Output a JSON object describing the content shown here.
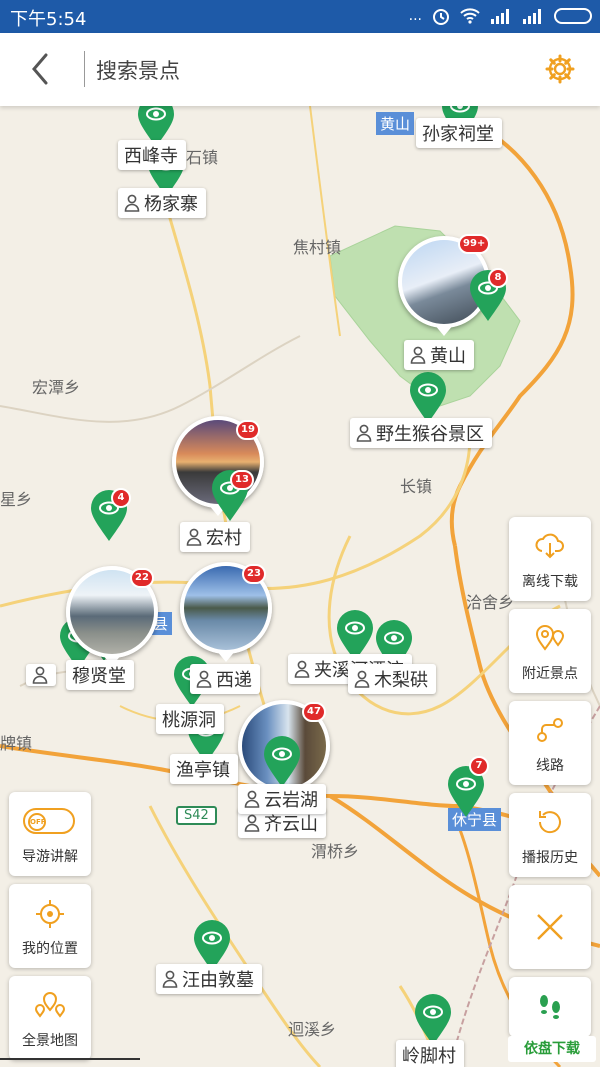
{
  "status": {
    "time": "下午5:54",
    "dots": "...",
    "colors": {
      "bar": "#1e5aa8"
    }
  },
  "header": {
    "title": "搜索景点",
    "back_icon": "chevron-left-icon",
    "settings_icon": "gear-icon"
  },
  "map": {
    "places": {
      "shi_zhen": "石镇",
      "jiao_cun": "焦村镇",
      "hong_tan": "宏潭乡",
      "xing_xiang": "星乡",
      "chang_zhen": "长镇",
      "qia_she": "洽舍乡",
      "pai_zhen": "牌镇",
      "wei_qiao": "渭桥乡",
      "hui_xi": "迴溪乡",
      "xian": "县",
      "huangshan_town": "黄山",
      "xiuning": "休宁县",
      "road_s42": "S42",
      "jiao_zhen": "山镇"
    },
    "labels": {
      "sunjia": "孙家祠堂",
      "xifeng": "西峰寺",
      "yangjiazhai": "杨家寨",
      "huangshan": "黄山",
      "yesheng": "野生猴谷景区",
      "hongcun": "宏村",
      "muxian": "穆贤堂",
      "xidi": "西递",
      "jiaxi": "夹溪河漂流",
      "muli": "木梨硔",
      "taoyuan": "桃源洞",
      "yuting": "渔亭镇",
      "yunyan": "云岩湖",
      "qiyun": "齐云山",
      "wangyou": "汪由敦墓",
      "lingjiao": "岭脚村"
    },
    "badges": {
      "huangshan_photo": "99+",
      "huangshan_pin": "8",
      "hongcun_photo": "19",
      "hongcun_pin": "13",
      "pin_4": "4",
      "muxian_photo": "22",
      "xidi_photo": "23",
      "yunyan_photo": "47",
      "xiuning_pin": "7"
    }
  },
  "right_tools": {
    "offline": {
      "label": "离线下载",
      "icon": "cloud-download-icon"
    },
    "nearby": {
      "label": "附近景点",
      "icon": "nearby-pins-icon"
    },
    "route": {
      "label": "线路",
      "icon": "route-icon"
    },
    "history": {
      "label": "播报历史",
      "icon": "history-icon"
    },
    "close": {
      "icon": "close-icon"
    },
    "footsteps": {
      "icon": "footsteps-icon"
    }
  },
  "left_tools": {
    "guide": {
      "label": "导游讲解",
      "toggle_text": "OFF"
    },
    "location": {
      "label": "我的位置"
    },
    "panorama": {
      "label": "全景地图"
    }
  },
  "watermark": "依盘下载",
  "colors": {
    "pin": "#23a35a",
    "badge": "#e02a2a",
    "accent": "#f0a020"
  }
}
